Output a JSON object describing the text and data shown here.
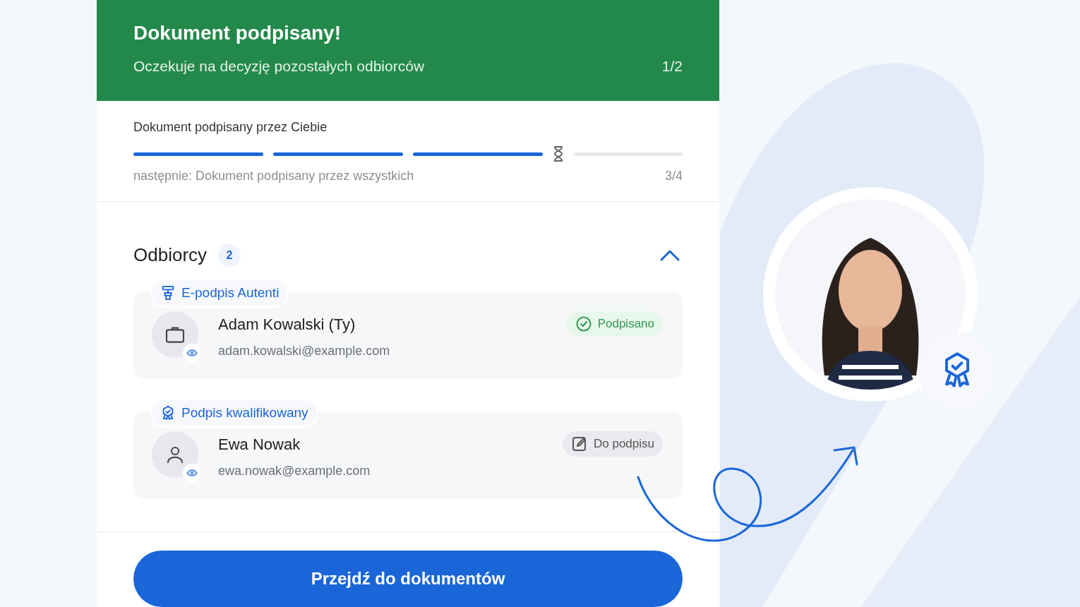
{
  "banner": {
    "title": "Dokument podpisany!",
    "subtitle": "Oczekuje na decyzję pozostałych odbiorców",
    "counter": "1/2"
  },
  "progress": {
    "label": "Dokument podpisany przez Ciebie",
    "next": "następnie: Dokument podpisany przez wszystkich",
    "counter": "3/4",
    "steps": [
      {
        "done": true
      },
      {
        "done": true
      },
      {
        "done": true
      },
      {
        "done": false
      }
    ]
  },
  "recipients": {
    "title": "Odbiorcy",
    "count": "2",
    "expanded": true,
    "items": [
      {
        "signature": {
          "kind": "electronic",
          "label": "E-podpis Autenti"
        },
        "avatar": {
          "kind": "company"
        },
        "name": "Adam Kowalski (Ty)",
        "email": "adam.kowalski@example.com",
        "status": {
          "kind": "signed",
          "text": "Podpisano"
        }
      },
      {
        "signature": {
          "kind": "qualified",
          "label": "Podpis kwalifikowany"
        },
        "avatar": {
          "kind": "person"
        },
        "name": "Ewa Nowak",
        "email": "ewa.nowak@example.com",
        "status": {
          "kind": "pending",
          "text": "Do podpisu"
        }
      }
    ]
  },
  "primary_button": "Przejdź do dokumentów"
}
